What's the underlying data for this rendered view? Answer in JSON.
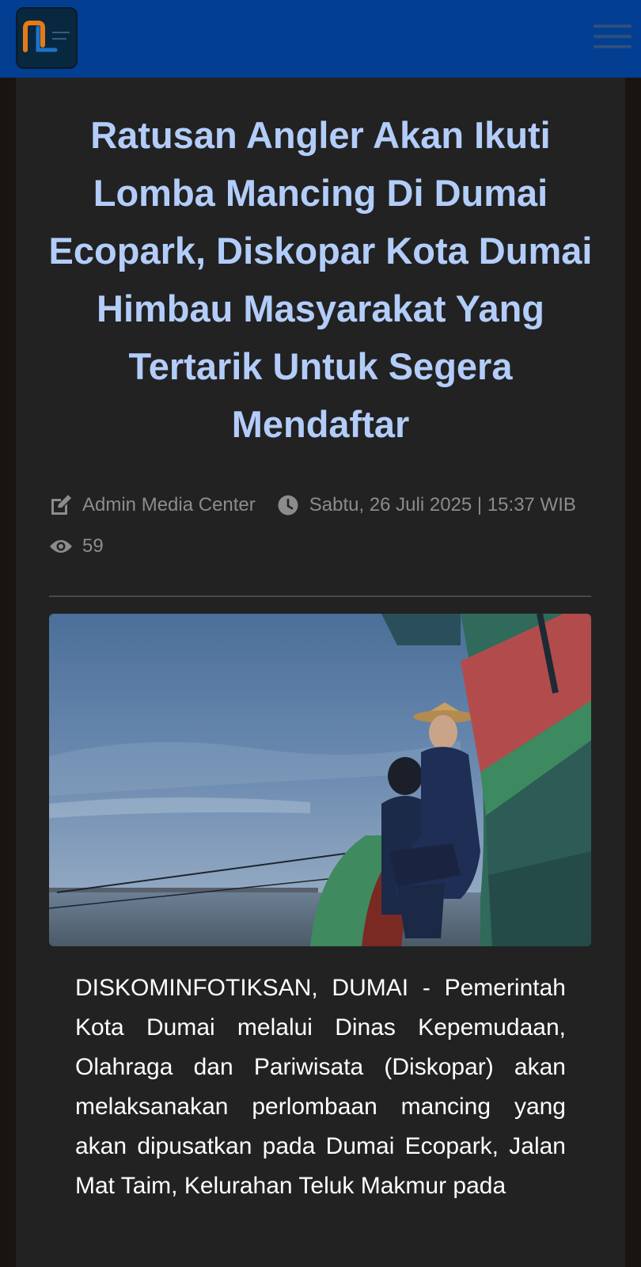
{
  "header": {
    "logo_icon": "site-logo",
    "menu_icon": "hamburger-menu-icon",
    "colors": {
      "bar": "#023f92",
      "logo_accent": "#e57a16"
    }
  },
  "article": {
    "title": "Ratusan Angler Akan Ikuti Lomba Mancing Di Dumai Ecopark, Diskopar Kota Dumai Himbau Masyarakat Yang Tertarik Untuk Segera Mendaftar",
    "author": "Admin Media Center",
    "date": "Sabtu, 26 Juli 2025 | 15:37 WIB",
    "views": "59",
    "icons": {
      "author": "edit-icon",
      "date": "clock-icon",
      "views": "eye-icon"
    },
    "image_icon": "article-photo",
    "body": "DISKOMINFOTIKSAN, DUMAI - Pemerintah Kota Dumai melalui Dinas Kepemudaan, Olahraga dan Pariwisata (Diskopar) akan melaksanakan perlombaan mancing yang akan dipusatkan pada Dumai Ecopark, Jalan Mat Taim, Kelurahan Teluk Makmur pada",
    "colors": {
      "title": "#b3cdfa",
      "background": "#222222",
      "meta": "#8c8c8c"
    }
  }
}
